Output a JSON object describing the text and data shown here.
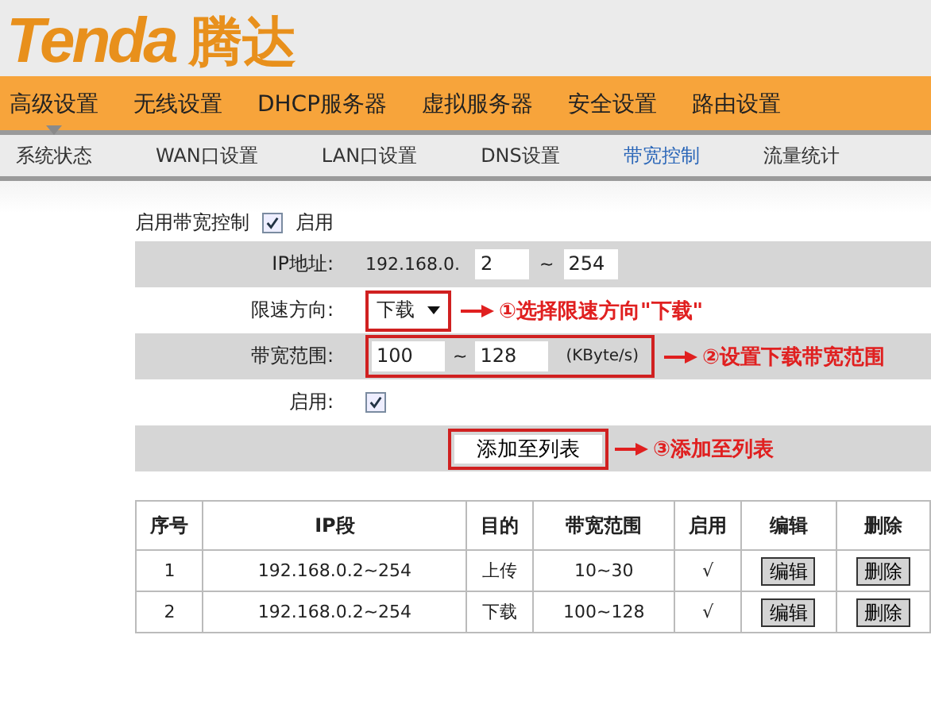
{
  "logo": {
    "brand": "Tenda",
    "chinese": "腾达"
  },
  "main_nav": [
    {
      "label": "高级设置",
      "selected": true
    },
    {
      "label": "无线设置",
      "selected": false
    },
    {
      "label": "DHCP服务器",
      "selected": false
    },
    {
      "label": "虚拟服务器",
      "selected": false
    },
    {
      "label": "安全设置",
      "selected": false
    },
    {
      "label": "路由设置",
      "selected": false
    }
  ],
  "sub_nav": [
    {
      "label": "系统状态",
      "selected": false
    },
    {
      "label": "WAN口设置",
      "selected": false
    },
    {
      "label": "LAN口设置",
      "selected": false
    },
    {
      "label": "DNS设置",
      "selected": false
    },
    {
      "label": "带宽控制",
      "selected": true
    },
    {
      "label": "流量统计",
      "selected": false
    }
  ],
  "form": {
    "enable": {
      "label": "启用带宽控制",
      "checked": true,
      "text": "启用"
    },
    "ip": {
      "label": "IP地址:",
      "prefix": "192.168.0.",
      "start": "2",
      "separator": "~",
      "end": "254"
    },
    "direction": {
      "label": "限速方向:",
      "value": "下载",
      "annotation": "①选择限速方向\"下载\""
    },
    "bandwidth": {
      "label": "带宽范围:",
      "min": "100",
      "separator": "~",
      "max": "128",
      "unit": "(KByte/s)",
      "annotation": "②设置下载带宽范围"
    },
    "enabled": {
      "label": "启用:",
      "checked": true
    },
    "add_button": {
      "label": "添加至列表",
      "annotation": "③添加至列表"
    }
  },
  "table": {
    "columns": [
      "序号",
      "IP段",
      "目的",
      "带宽范围",
      "启用",
      "编辑",
      "删除"
    ],
    "rows": [
      {
        "cells": [
          "1",
          "192.168.0.2~254",
          "上传",
          "10~30",
          "√"
        ],
        "edit": "编辑",
        "delete": "删除"
      },
      {
        "cells": [
          "2",
          "192.168.0.2~254",
          "下载",
          "100~128",
          "√"
        ],
        "edit": "编辑",
        "delete": "删除"
      }
    ]
  }
}
